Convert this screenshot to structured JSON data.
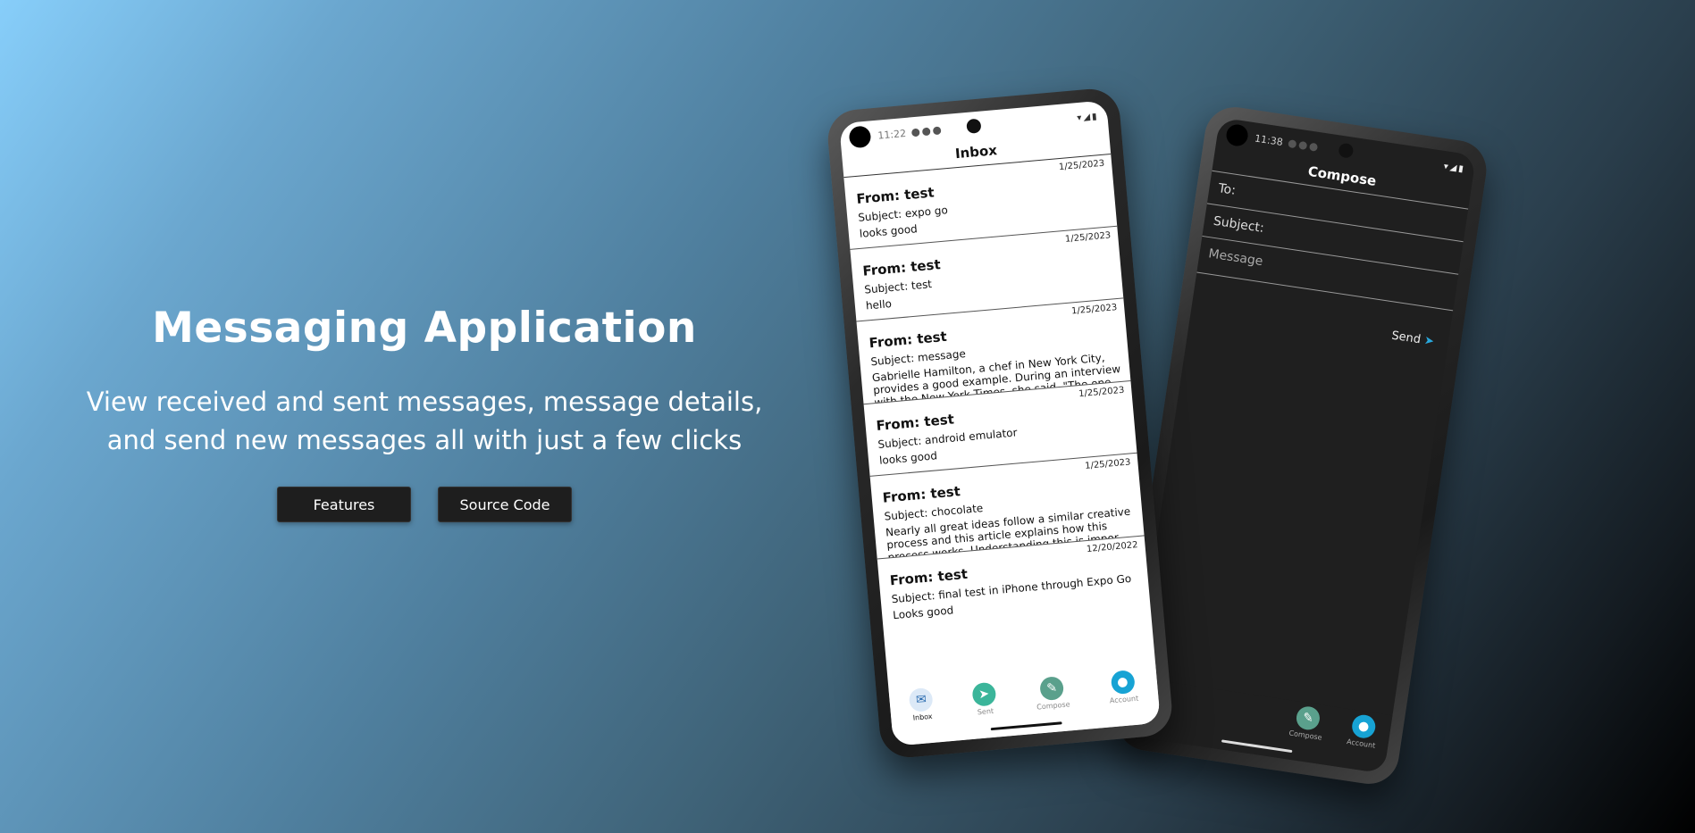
{
  "hero": {
    "title": "Messaging Application",
    "subtitle_line1": "View received and sent messages, message details,",
    "subtitle_line2": "and send new messages all with just a few clicks",
    "buttons": {
      "features": "Features",
      "source_code": "Source Code"
    }
  },
  "front_phone": {
    "time": "11:22",
    "title": "Inbox",
    "messages": [
      {
        "date": "1/25/2023",
        "from": "From: test",
        "subject": "Subject: expo go",
        "body": "looks good"
      },
      {
        "date": "1/25/2023",
        "from": "From: test",
        "subject": "Subject: test",
        "body": "hello"
      },
      {
        "date": "1/25/2023",
        "from": "From: test",
        "subject": "Subject: message",
        "body": "Gabrielle Hamilton, a chef in New York City, provides a good example. During an interview with the New York Times, she said, \"The one ..."
      },
      {
        "date": "1/25/2023",
        "from": "From: test",
        "subject": "Subject: android emulator",
        "body": "looks good"
      },
      {
        "date": "1/25/2023",
        "from": "From: test",
        "subject": "Subject: chocolate",
        "body": "Nearly all great ideas follow a similar creative process and this article explains how this process works. Understanding this is impor..."
      },
      {
        "date": "12/20/2022",
        "from": "From: test",
        "subject": "Subject: final test in iPhone through Expo Go",
        "body": "Looks good"
      }
    ],
    "tabs": [
      {
        "label": "Inbox",
        "icon": "inbox-icon",
        "color": "#dce9f7"
      },
      {
        "label": "Sent",
        "icon": "paper-plane-icon",
        "color": "#3bb59a"
      },
      {
        "label": "Compose",
        "icon": "compose-icon",
        "color": "#5aa08c"
      },
      {
        "label": "Account",
        "icon": "account-icon",
        "color": "#17a3d4"
      }
    ]
  },
  "back_phone": {
    "time": "11:38",
    "title": "Compose",
    "to_label": "To:",
    "subject_label": "Subject:",
    "message_placeholder": "Message",
    "send_label": "Send",
    "tabs": [
      {
        "label": "Compose",
        "icon": "compose-icon",
        "color": "#5aa08c"
      },
      {
        "label": "Account",
        "icon": "account-icon",
        "color": "#17a3d4"
      }
    ]
  }
}
